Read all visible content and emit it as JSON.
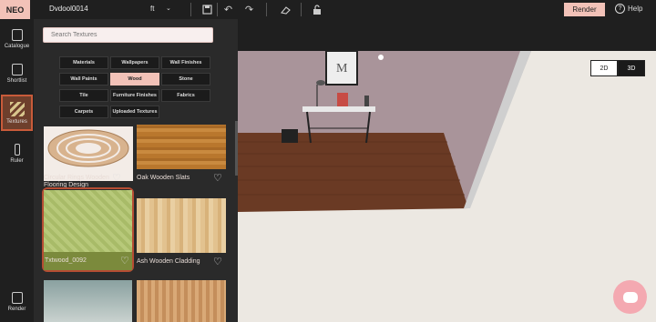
{
  "app": {
    "logo": "NEO",
    "design_name": "Dvdool0014",
    "unit": "ft",
    "render_label": "Render",
    "help_label": "Help"
  },
  "leftnav": {
    "items": [
      {
        "label": "Catalogue",
        "icon": "catalogue-icon"
      },
      {
        "label": "Shortlist",
        "icon": "shortlist-icon"
      },
      {
        "label": "Textures",
        "icon": "textures-icon"
      },
      {
        "label": "Ruler",
        "icon": "ruler-icon"
      },
      {
        "label": "Render",
        "icon": "render-icon"
      }
    ]
  },
  "panel": {
    "search_placeholder": "Search Textures",
    "categories": [
      {
        "label": "Materials",
        "active": false
      },
      {
        "label": "Wallpapers",
        "active": false
      },
      {
        "label": "Wall Finishes",
        "active": false
      },
      {
        "label": "Wall Paints",
        "active": false
      },
      {
        "label": "Wood",
        "active": true
      },
      {
        "label": "Stone",
        "active": false
      },
      {
        "label": "Tile",
        "active": false
      },
      {
        "label": "Furniture Finishes",
        "active": false
      },
      {
        "label": "Fabrics",
        "active": false
      },
      {
        "label": "Carpets",
        "active": false
      },
      {
        "label": "Uploaded Textures",
        "active": false
      }
    ],
    "textures": [
      {
        "name": "Circular Rings Wooden Flooring Design"
      },
      {
        "name": "Oak Wooden Slats"
      },
      {
        "name": "Txtwood_0092"
      },
      {
        "name": "Ash Wooden Cladding"
      }
    ]
  },
  "viewport": {
    "view_2d": "2D",
    "view_3d": "3D",
    "active_view": "3D"
  },
  "colors": {
    "accent": "#f2c2b8",
    "selected_border": "#b64d33",
    "chat": "#f4a9b1"
  }
}
